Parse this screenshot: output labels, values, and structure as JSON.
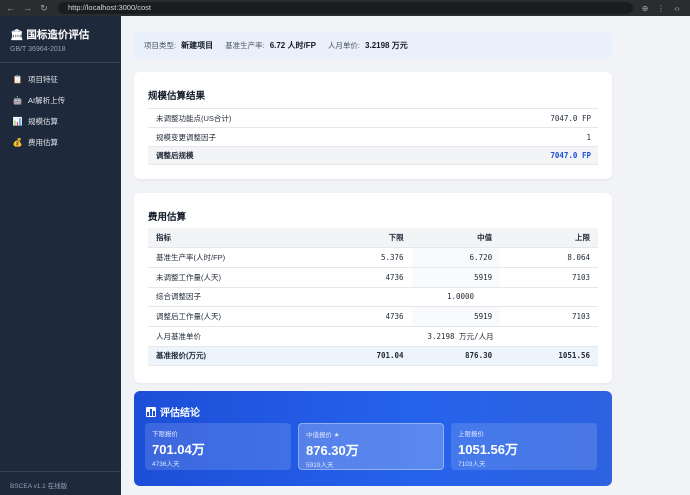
{
  "browser": {
    "url": "http://localhost:3000/cost"
  },
  "sidebar": {
    "title": "国标造价评估",
    "subtitle": "GB/T 36964-2018",
    "items": [
      {
        "label": "项目特征",
        "icon": "clipboard-icon"
      },
      {
        "label": "AI解析上传",
        "icon": "robot-icon"
      },
      {
        "label": "规模估算",
        "icon": "bar-chart-icon"
      },
      {
        "label": "费用估算",
        "icon": "money-bag-icon"
      }
    ],
    "footer": "BSCEA v1.1 在线版"
  },
  "info": {
    "type_label": "项目类型:",
    "type_value": "新建项目",
    "prod_label": "基准生产率:",
    "prod_value": "6.72 人时/FP",
    "price_label": "人月单价:",
    "price_value": "3.2198 万元"
  },
  "scale": {
    "title": "规模估算结果",
    "rows": [
      {
        "label": "未调整功能点(US合计)",
        "value": "7047.0 FP"
      },
      {
        "label": "规模变更调整因子",
        "value": "1"
      },
      {
        "label": "调整后规模",
        "value": "7047.0 FP"
      }
    ]
  },
  "cost": {
    "title": "费用估算",
    "headers": [
      "指标",
      "下限",
      "中值",
      "上限"
    ],
    "rows": [
      {
        "label": "基准生产率(人时/FP)",
        "low": "5.376",
        "mid": "6.720",
        "high": "8.064"
      },
      {
        "label": "未调整工作量(人天)",
        "low": "4736",
        "mid": "5919",
        "high": "7103"
      },
      {
        "label": "综合调整因子",
        "span": "1.0000"
      },
      {
        "label": "调整后工作量(人天)",
        "low": "4736",
        "mid": "5919",
        "high": "7103"
      },
      {
        "label": "人月基准单价",
        "span": "3.2198 万元/人月"
      },
      {
        "label": "基准报价(万元)",
        "low": "701.04",
        "mid": "876.30",
        "high": "1051.56"
      }
    ]
  },
  "conclusion": {
    "title": "评估结论",
    "low": {
      "label": "下限报价",
      "value": "701.04万",
      "sub": "4736人天"
    },
    "mid": {
      "label": "中值报价 ★",
      "value": "876.30万",
      "sub": "5919人天"
    },
    "high": {
      "label": "上限报价",
      "value": "1051.56万",
      "sub": "7103人天"
    }
  },
  "colors": {
    "sidebar": "#1e293b",
    "accent": "#1d4ed8",
    "info_bg": "#eaf0fb"
  }
}
